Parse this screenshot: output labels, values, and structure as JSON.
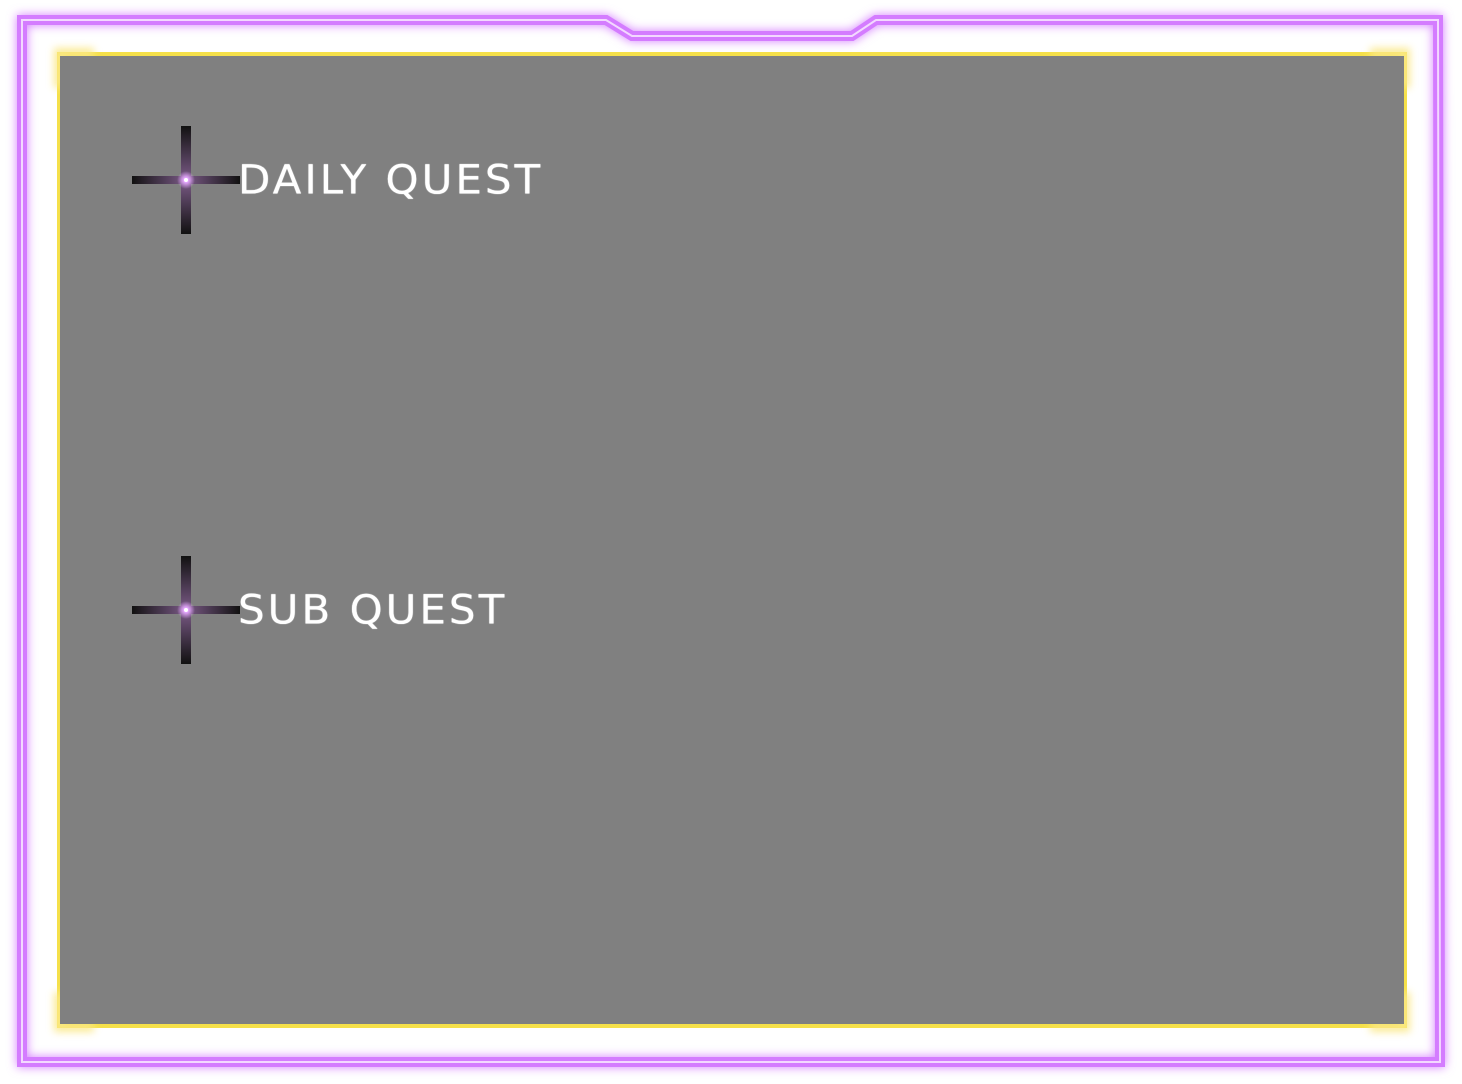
{
  "quest_panel": {
    "sections": [
      {
        "title": "DAILY QUEST",
        "icon": "sparkle-icon"
      },
      {
        "title": "SUB QUEST",
        "icon": "sparkle-icon"
      }
    ]
  },
  "colors": {
    "outer_glow": "#d47cff",
    "inner_border": "#f5e04a",
    "panel_fill": "#808080",
    "heading_text": "#ffffff"
  }
}
